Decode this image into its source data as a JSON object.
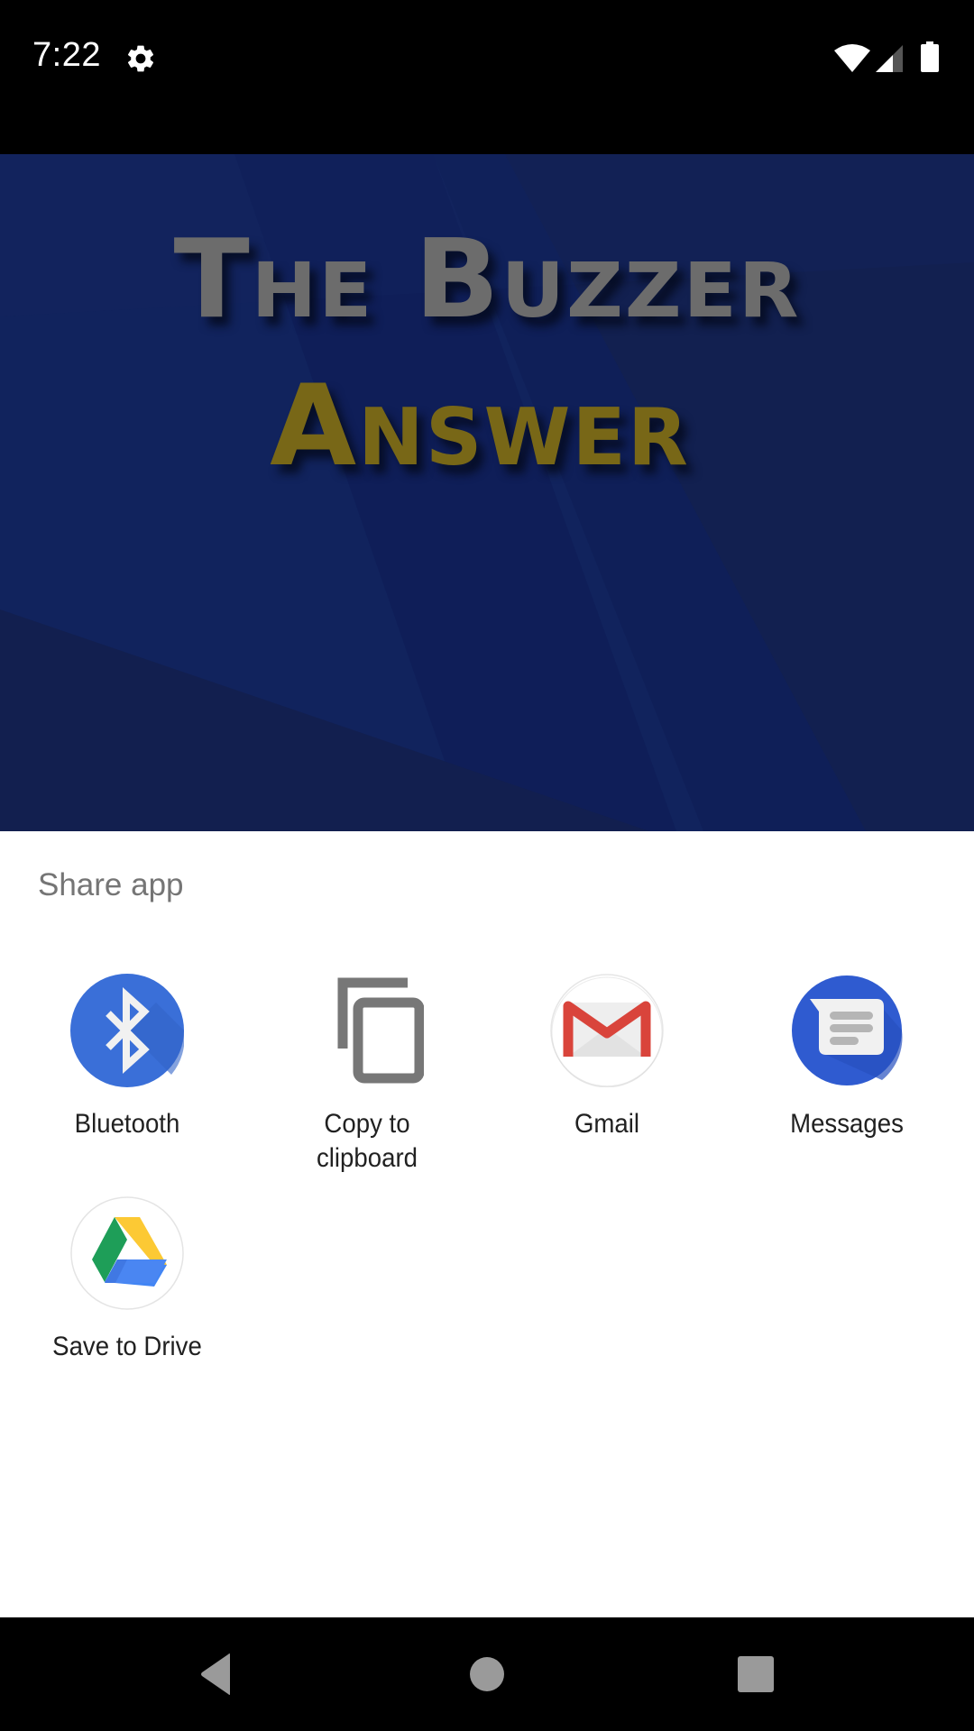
{
  "status_bar": {
    "time": "7:22",
    "icons": [
      "gear-icon",
      "wifi-icon",
      "cell-signal-icon",
      "battery-icon"
    ]
  },
  "banner": {
    "title_line1": "The Buzzer",
    "title_line2": "Answer",
    "colors": {
      "background": "#0f1f58",
      "title_line1": "#6c6c6c",
      "title_line2": "#786717"
    }
  },
  "share_sheet": {
    "title": "Share app",
    "targets": [
      {
        "label": "Bluetooth",
        "icon": "bluetooth-icon"
      },
      {
        "label": "Copy to clipboard",
        "label_line1": "Copy to",
        "label_line2": "clipboard",
        "icon": "copy-icon"
      },
      {
        "label": "Gmail",
        "icon": "gmail-icon"
      },
      {
        "label": "Messages",
        "icon": "messages-icon"
      },
      {
        "label": "Save to Drive",
        "icon": "drive-icon"
      }
    ]
  },
  "nav_bar": {
    "buttons": [
      "back",
      "home",
      "recents"
    ]
  }
}
